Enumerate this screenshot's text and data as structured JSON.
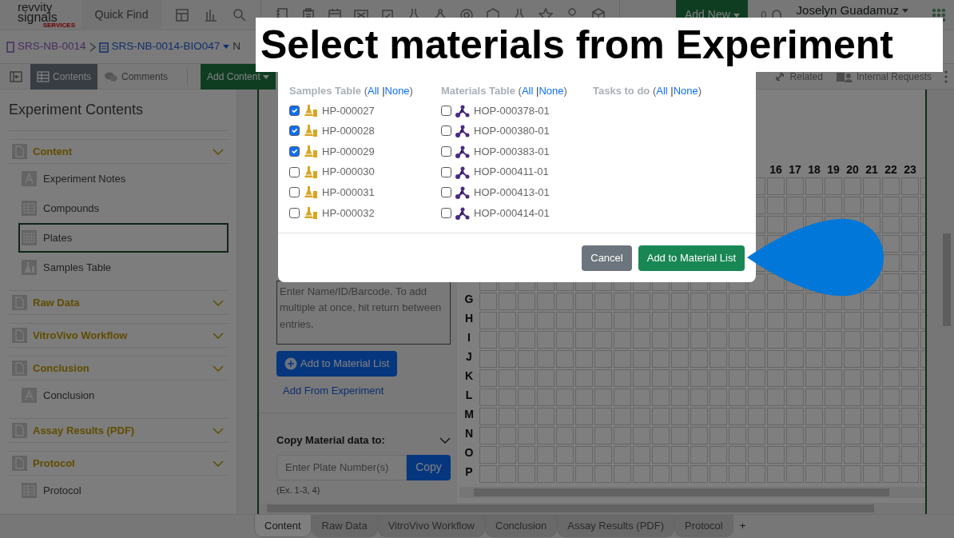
{
  "top_bar": {
    "logo": {
      "line_1": "revvity",
      "line_2": "signals",
      "line_3": "SERVICES"
    },
    "quick_find": "Quick Find",
    "add_new": "Add New",
    "notification_count": "0",
    "user": "Joselyn Guadamuz"
  },
  "breadcrumb": [
    {
      "label": "SRS-NB-0014",
      "kind": "notebook"
    },
    {
      "label": "SRS-NB-0014-BIO047",
      "kind": "experiment"
    },
    {
      "label": "N",
      "kind": "plain"
    }
  ],
  "toolbar": {
    "tabs": [
      {
        "label": "Contents",
        "selected": true
      },
      {
        "label": "Comments",
        "selected": false
      }
    ],
    "add_content": "Add Content",
    "right_links": [
      {
        "label": "Related",
        "kind": "related"
      },
      {
        "label": "Internal Requests",
        "kind": "requests"
      }
    ]
  },
  "sidebar": {
    "title": "Experiment Contents",
    "sections": [
      {
        "label": "Content",
        "children": [
          {
            "label": "Experiment Notes",
            "kind": "text",
            "selected": false
          },
          {
            "label": "Compounds",
            "kind": "table",
            "selected": false
          },
          {
            "label": "Plates",
            "kind": "grid",
            "selected": true
          },
          {
            "label": "Samples Table",
            "kind": "samples",
            "selected": false
          }
        ]
      },
      {
        "label": "Raw Data"
      },
      {
        "label": "VitroVivo Workflow"
      },
      {
        "label": "Conclusion",
        "children": [
          {
            "label": "Conclusion",
            "kind": "text",
            "selected": false
          }
        ]
      },
      {
        "label": "Assay Results (PDF)"
      },
      {
        "label": "Protocol",
        "children": [
          {
            "label": "Protocol",
            "kind": "table",
            "selected": false
          }
        ]
      }
    ]
  },
  "material_panel": {
    "input_placeholder": "Enter Name/ID/Barcode. To add multiple at once, hit return between entries.",
    "add_button": "Add to Material List",
    "add_from_experiment": "Add From Experiment",
    "copy_title": "Copy Material data to:",
    "copy_placeholder": "Enter Plate Number(s)",
    "copy_button": "Copy",
    "copy_hint": "(Ex. 1-3, 4)"
  },
  "plate": {
    "columns": [
      "16",
      "17",
      "18",
      "19",
      "20",
      "21",
      "22",
      "23"
    ],
    "rows": [
      "G",
      "H",
      "I",
      "J",
      "K",
      "L",
      "M",
      "N",
      "O",
      "P"
    ]
  },
  "bottom_tabs": [
    {
      "label": "Content",
      "selected": true
    },
    {
      "label": "Raw Data",
      "selected": false
    },
    {
      "label": "VitroVivo Workflow",
      "selected": false
    },
    {
      "label": "Conclusion",
      "selected": false
    },
    {
      "label": "Assay Results (PDF)",
      "selected": false
    },
    {
      "label": "Protocol",
      "selected": false
    }
  ],
  "add_tab": "+",
  "dialog": {
    "groups": [
      {
        "title": "Samples Table",
        "open": "(",
        "all": "All",
        "separator": "|",
        "none": "None",
        "close": ")",
        "items": [
          {
            "label": "HP-000027",
            "kind": "sample",
            "checked": true
          },
          {
            "label": "HP-000028",
            "kind": "sample",
            "checked": true
          },
          {
            "label": "HP-000029",
            "kind": "sample",
            "checked": true
          },
          {
            "label": "HP-000030",
            "kind": "sample",
            "checked": false
          },
          {
            "label": "HP-000031",
            "kind": "sample",
            "checked": false
          },
          {
            "label": "HP-000032",
            "kind": "sample",
            "checked": false
          }
        ]
      },
      {
        "title": "Materials Table",
        "open": "(",
        "all": "All",
        "separator": "|",
        "none": "None",
        "close": ")",
        "items": [
          {
            "label": "HOP-000378-01",
            "kind": "material",
            "checked": false
          },
          {
            "label": "HOP-000380-01",
            "kind": "material",
            "checked": false
          },
          {
            "label": "HOP-000383-01",
            "kind": "material",
            "checked": false
          },
          {
            "label": "HOP-000411-01",
            "kind": "material",
            "checked": false
          },
          {
            "label": "HOP-000413-01",
            "kind": "material",
            "checked": false
          },
          {
            "label": "HOP-000414-01",
            "kind": "material",
            "checked": false
          }
        ]
      },
      {
        "title": "Tasks to do",
        "open": "(",
        "all": "All",
        "separator": "|",
        "none": "None",
        "close": ")"
      }
    ],
    "cancel": "Cancel",
    "confirm": "Add to Material List"
  },
  "banner": {
    "title": "Select materials from Experiment"
  }
}
